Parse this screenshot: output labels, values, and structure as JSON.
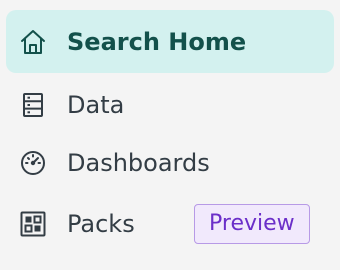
{
  "nav": {
    "items": [
      {
        "label": "Search Home",
        "icon": "home-icon",
        "active": true
      },
      {
        "label": "Data",
        "icon": "database-icon",
        "active": false
      },
      {
        "label": "Dashboards",
        "icon": "gauge-icon",
        "active": false
      },
      {
        "label": "Packs",
        "icon": "grid-icon",
        "active": false,
        "badge": "Preview"
      }
    ]
  },
  "colors": {
    "active_bg": "#d3f1ef",
    "active_text": "#13514b",
    "text": "#333d45",
    "badge_border": "#b79ae6",
    "badge_bg": "#f1e9fc",
    "badge_text": "#6b2fc9"
  }
}
